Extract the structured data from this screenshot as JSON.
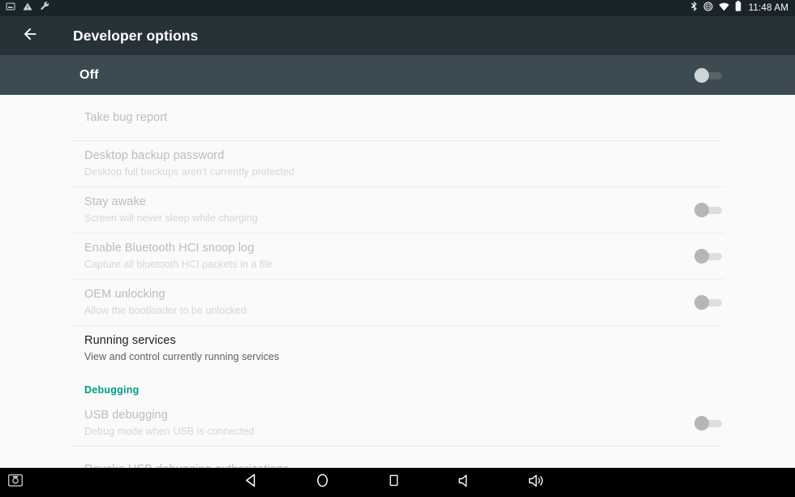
{
  "statusbar": {
    "left_icons": [
      {
        "name": "screenshot-icon"
      },
      {
        "name": "warning-icon"
      },
      {
        "name": "wrench-icon"
      }
    ],
    "right_icons": [
      {
        "name": "bluetooth-icon"
      },
      {
        "name": "do-not-disturb-icon"
      },
      {
        "name": "wifi-icon"
      },
      {
        "name": "battery-icon"
      }
    ],
    "clock": "11:48 AM"
  },
  "appbar": {
    "back_label": "Back",
    "title": "Developer options"
  },
  "master": {
    "label": "Off",
    "state": "off"
  },
  "colors": {
    "statusbar_bg": "#19232a",
    "appbar_bg": "#263238",
    "masterbar_bg": "#3c4b52",
    "content_bg": "#fafafa",
    "section_accent": "#009a83",
    "divider": "#ececf0",
    "navbar_bg": "#000000"
  },
  "list": [
    {
      "id": "take-bug-report",
      "title": "Take bug report",
      "summary": "",
      "enabled": false,
      "switch": null,
      "divider_after": true
    },
    {
      "id": "desktop-backup-password",
      "title": "Desktop backup password",
      "summary": "Desktop full backups aren't currently protected",
      "enabled": false,
      "switch": null,
      "divider_after": true
    },
    {
      "id": "stay-awake",
      "title": "Stay awake",
      "summary": "Screen will never sleep while charging",
      "enabled": false,
      "switch": "off",
      "divider_after": true
    },
    {
      "id": "enable-bluetooth-hci-snoop-log",
      "title": "Enable Bluetooth HCI snoop log",
      "summary": "Capture all bluetooth HCI packets in a file",
      "enabled": false,
      "switch": "off",
      "divider_after": true
    },
    {
      "id": "oem-unlocking",
      "title": "OEM unlocking",
      "summary": "Allow the bootloader to be unlocked",
      "enabled": false,
      "switch": "off",
      "divider_after": true
    },
    {
      "id": "running-services",
      "title": "Running services",
      "summary": "View and control currently running services",
      "enabled": true,
      "switch": null,
      "divider_after": false
    }
  ],
  "debugging_section": {
    "header": "Debugging",
    "items": [
      {
        "id": "usb-debugging",
        "title": "USB debugging",
        "summary": "Debug mode when USB is connected",
        "enabled": false,
        "switch": "off",
        "divider_after": true
      },
      {
        "id": "revoke-usb-debugging-authorizations",
        "title": "Revoke USB debugging authorizations",
        "summary": "",
        "enabled": false,
        "switch": null,
        "divider_after": false
      }
    ]
  },
  "navbar": {
    "buttons": [
      {
        "name": "screenshot-button",
        "label": "Screenshot"
      },
      {
        "name": "back-button",
        "label": "Back"
      },
      {
        "name": "home-button",
        "label": "Home"
      },
      {
        "name": "recents-button",
        "label": "Recent apps"
      },
      {
        "name": "volume-down-button",
        "label": "Volume down"
      },
      {
        "name": "volume-up-button",
        "label": "Volume up"
      }
    ]
  }
}
